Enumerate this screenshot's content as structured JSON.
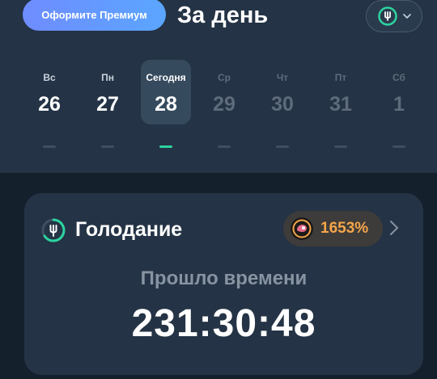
{
  "header": {
    "premium_label": "Оформите Премиум",
    "title": "За день",
    "plan_icon": "fork-icon",
    "accent": "#2cd4a0"
  },
  "days": [
    {
      "name": "Вс",
      "date": "26",
      "state": "past"
    },
    {
      "name": "Пн",
      "date": "27",
      "state": "past"
    },
    {
      "name": "Сегодня",
      "date": "28",
      "state": "today"
    },
    {
      "name": "Ср",
      "date": "29",
      "state": "future"
    },
    {
      "name": "Чт",
      "date": "30",
      "state": "future"
    },
    {
      "name": "Пт",
      "date": "31",
      "state": "future"
    },
    {
      "name": "Сб",
      "date": "1",
      "state": "future"
    }
  ],
  "fasting": {
    "title": "Голодание",
    "badge_value": "1653%",
    "badge_color": "#f5a54a",
    "elapsed_label": "Прошло времени",
    "elapsed_value": "231:30:48"
  }
}
